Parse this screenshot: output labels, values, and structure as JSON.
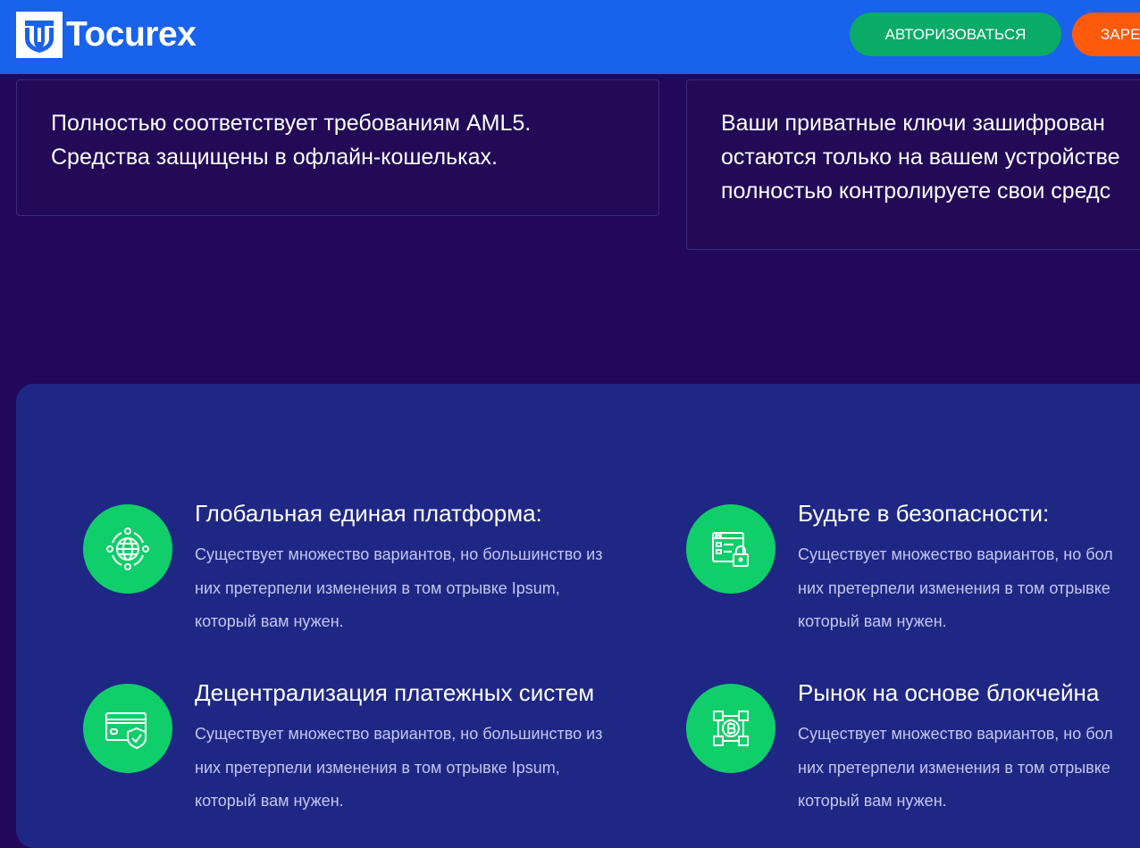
{
  "header": {
    "logo_text": "Tocurex",
    "login_label": "АВТОРИЗОВАТЬСЯ",
    "register_label": "ЗАРЕ",
    "bg_color": "#1862ec",
    "login_color": "#09ab66",
    "register_color": "#fe5a0b"
  },
  "cards": [
    {
      "lines": [
        "Полностью соответствует требованиям AML5.",
        "Средства защищены в офлайн-кошельках."
      ]
    },
    {
      "lines": [
        "Ваши приватные ключи зашифрован",
        "остаются только на вашем устройстве",
        "полностью контролируете свои средс"
      ]
    }
  ],
  "features": [
    {
      "title": "Глобальная единая платформа:",
      "desc_lines": [
        "Существует множество вариантов, но большинство из",
        "них претерпели изменения в том отрывке Ipsum,",
        "который вам нужен."
      ],
      "icon": "globe-network-icon"
    },
    {
      "title": "Будьте в безопасности:",
      "desc_lines": [
        "Существует множество вариантов, но бол",
        "них претерпели изменения в том отрывке",
        "который вам нужен."
      ],
      "icon": "secure-browser-lock-icon"
    },
    {
      "title": "Децентрализация платежных систем",
      "desc_lines": [
        "Существует множество вариантов, но большинство из",
        "них претерпели изменения в том отрывке Ipsum,",
        "который вам нужен."
      ],
      "icon": "card-shield-icon"
    },
    {
      "title": "Рынок на основе блокчейна",
      "desc_lines": [
        "Существует множество вариантов, но бол",
        "них претерпели изменения в том отрывке",
        "который вам нужен."
      ],
      "icon": "blockchain-bitcoin-icon"
    }
  ],
  "colors": {
    "page_bg": "#22085a",
    "features_panel": "#1f2785",
    "icon_circle": "#10cf6a"
  }
}
